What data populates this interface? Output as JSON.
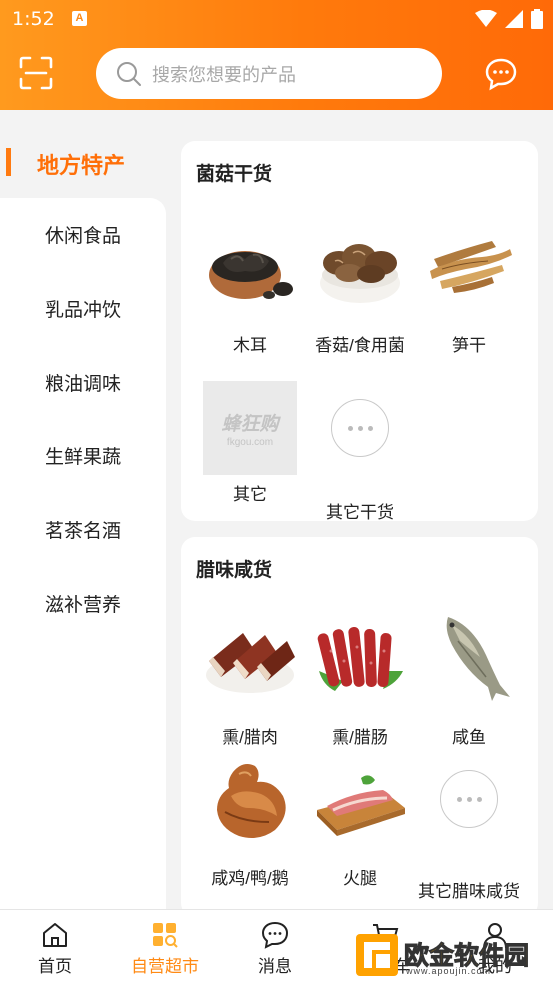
{
  "status_bar": {
    "time": "1:52",
    "notification_letter": "A"
  },
  "search": {
    "placeholder": "搜索您想要的产品"
  },
  "sidebar": {
    "active": "地方特产",
    "items": [
      "休闲食品",
      "乳品冲饮",
      "粮油调味",
      "生鲜果蔬",
      "茗茶名酒",
      "滋补营养"
    ]
  },
  "sections": [
    {
      "title": "菌菇干货",
      "products": [
        {
          "name": "木耳",
          "icon": "wood-ear-image"
        },
        {
          "name": "香菇/食用菌",
          "icon": "shiitake-image"
        },
        {
          "name": "笋干",
          "icon": "bamboo-shoot-image"
        },
        {
          "name": "其它",
          "icon": "placeholder-image"
        },
        {
          "name": "其它干货",
          "icon": "more-icon"
        }
      ]
    },
    {
      "title": "腊味咸货",
      "products": [
        {
          "name": "熏/腊肉",
          "icon": "cured-meat-image"
        },
        {
          "name": "熏/腊肠",
          "icon": "sausage-image"
        },
        {
          "name": "咸鱼",
          "icon": "salted-fish-image"
        },
        {
          "name": "咸鸡/鸭/鹅",
          "icon": "salted-poultry-image"
        },
        {
          "name": "火腿",
          "icon": "ham-image"
        },
        {
          "name": "其它腊味咸货",
          "icon": "more-icon"
        }
      ]
    }
  ],
  "placeholder_logo": {
    "main": "蜂狂购",
    "sub": "fkgou.com"
  },
  "nav": [
    {
      "label": "首页",
      "icon": "home-icon"
    },
    {
      "label": "自营超市",
      "icon": "grid-search-icon",
      "active": true
    },
    {
      "label": "消息",
      "icon": "chat-icon"
    },
    {
      "label": "购物车",
      "icon": "cart-icon"
    },
    {
      "label": "我的",
      "icon": "user-icon"
    }
  ],
  "watermark": {
    "text": "欧金软件园",
    "sub": "www.apoujin.com"
  },
  "colors": {
    "accent": "#ff7a10",
    "active_nav": "#ff8a14"
  }
}
